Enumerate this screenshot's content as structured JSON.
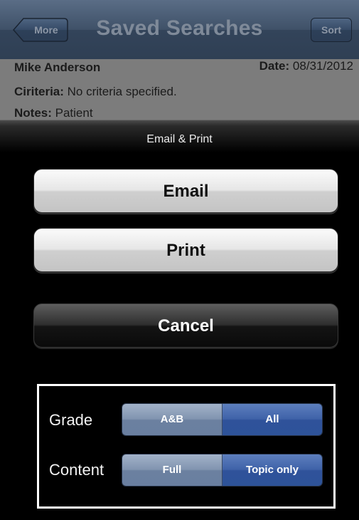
{
  "navbar": {
    "title": "Saved Searches",
    "back_label": "More",
    "sort_label": "Sort"
  },
  "record": {
    "name": "Mike Anderson",
    "date_label": "Date:",
    "date_value": "08/31/2012",
    "criteria_label": "Ciriteria:",
    "criteria_value": "No criteria specified.",
    "notes_label": "Notes:",
    "notes_value": "Patient"
  },
  "action_sheet": {
    "title": "Email & Print",
    "email_label": "Email",
    "print_label": "Print",
    "cancel_label": "Cancel"
  },
  "options": {
    "grade": {
      "label": "Grade",
      "segments": [
        "A&B",
        "All"
      ],
      "selected": "All"
    },
    "content": {
      "label": "Content",
      "segments": [
        "Full",
        "Topic only"
      ],
      "selected": "Topic only"
    }
  },
  "colors": {
    "segment_selected": "#3f62a8",
    "segment_unselected": "#8194b0",
    "navbar": "#3f5168",
    "options_border": "#ffffff"
  }
}
